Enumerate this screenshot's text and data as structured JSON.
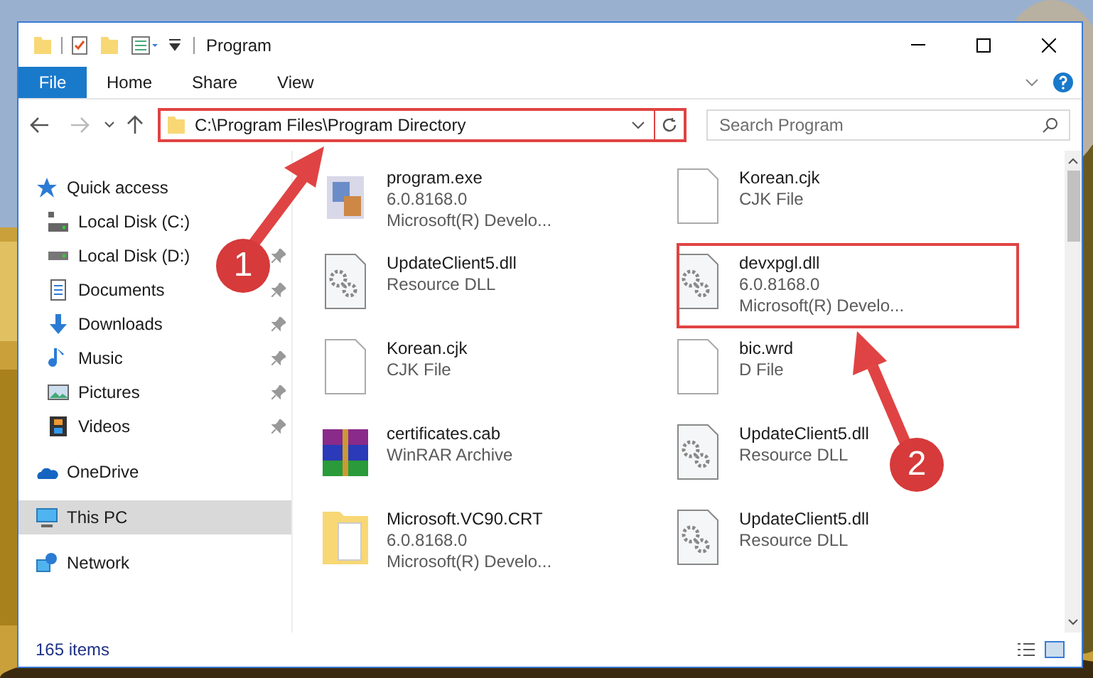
{
  "window": {
    "title": "Program"
  },
  "ribbon_tabs": [
    {
      "label": "File",
      "kind": "file"
    },
    {
      "label": "Home",
      "kind": "tab"
    },
    {
      "label": "Share",
      "kind": "tab"
    },
    {
      "label": "View",
      "kind": "tab"
    }
  ],
  "address": {
    "path": "C:\\Program Files\\Program Directory"
  },
  "search": {
    "placeholder": "Search Program"
  },
  "sidebar": {
    "items": [
      {
        "label": "Quick access",
        "kind": "star",
        "selected": false,
        "children": [
          {
            "label": "Local Disk (C:)",
            "kind": "system-drive",
            "pinned": false
          },
          {
            "label": "Local Disk (D:)",
            "kind": "drive",
            "pinned": true
          },
          {
            "label": "Documents",
            "kind": "documents",
            "pinned": true
          },
          {
            "label": "Downloads",
            "kind": "downloads",
            "pinned": true
          },
          {
            "label": "Music",
            "kind": "music",
            "pinned": true
          },
          {
            "label": "Pictures",
            "kind": "pictures",
            "pinned": true
          },
          {
            "label": "Videos",
            "kind": "videos",
            "pinned": true
          }
        ]
      },
      {
        "label": "OneDrive",
        "kind": "cloud",
        "selected": false
      },
      {
        "label": "This PC",
        "kind": "pc",
        "selected": true
      },
      {
        "label": "Network",
        "kind": "network",
        "selected": false
      }
    ]
  },
  "files": [
    {
      "name": "program.exe",
      "details": [
        "6.0.8168.0",
        "Microsoft(R) Develo..."
      ],
      "kind": "exe"
    },
    {
      "name": "Korean.cjk",
      "details": [
        "CJK File"
      ],
      "kind": "blank"
    },
    {
      "name": "UpdateClient5.dll",
      "details": [
        "Resource DLL"
      ],
      "kind": "dll"
    },
    {
      "name": "devxpgl.dll",
      "details": [
        "6.0.8168.0",
        "Microsoft(R) Develo..."
      ],
      "kind": "dll"
    },
    {
      "name": "Korean.cjk",
      "details": [
        "CJK File"
      ],
      "kind": "blank"
    },
    {
      "name": "bic.wrd",
      "details": [
        "D File"
      ],
      "kind": "blank"
    },
    {
      "name": "certificates.cab",
      "details": [
        "WinRAR Archive"
      ],
      "kind": "cab"
    },
    {
      "name": "UpdateClient5.dll",
      "details": [
        "Resource DLL"
      ],
      "kind": "dll"
    },
    {
      "name": "Microsoft.VC90.CRT",
      "details": [
        "6.0.8168.0",
        "Microsoft(R) Develo..."
      ],
      "kind": "folder"
    },
    {
      "name": "UpdateClient5.dll",
      "details": [
        "Resource DLL"
      ],
      "kind": "dll"
    }
  ],
  "annotations": [
    {
      "label": "1"
    },
    {
      "label": "2"
    }
  ],
  "status_bar": {
    "item_count": "165 items"
  }
}
